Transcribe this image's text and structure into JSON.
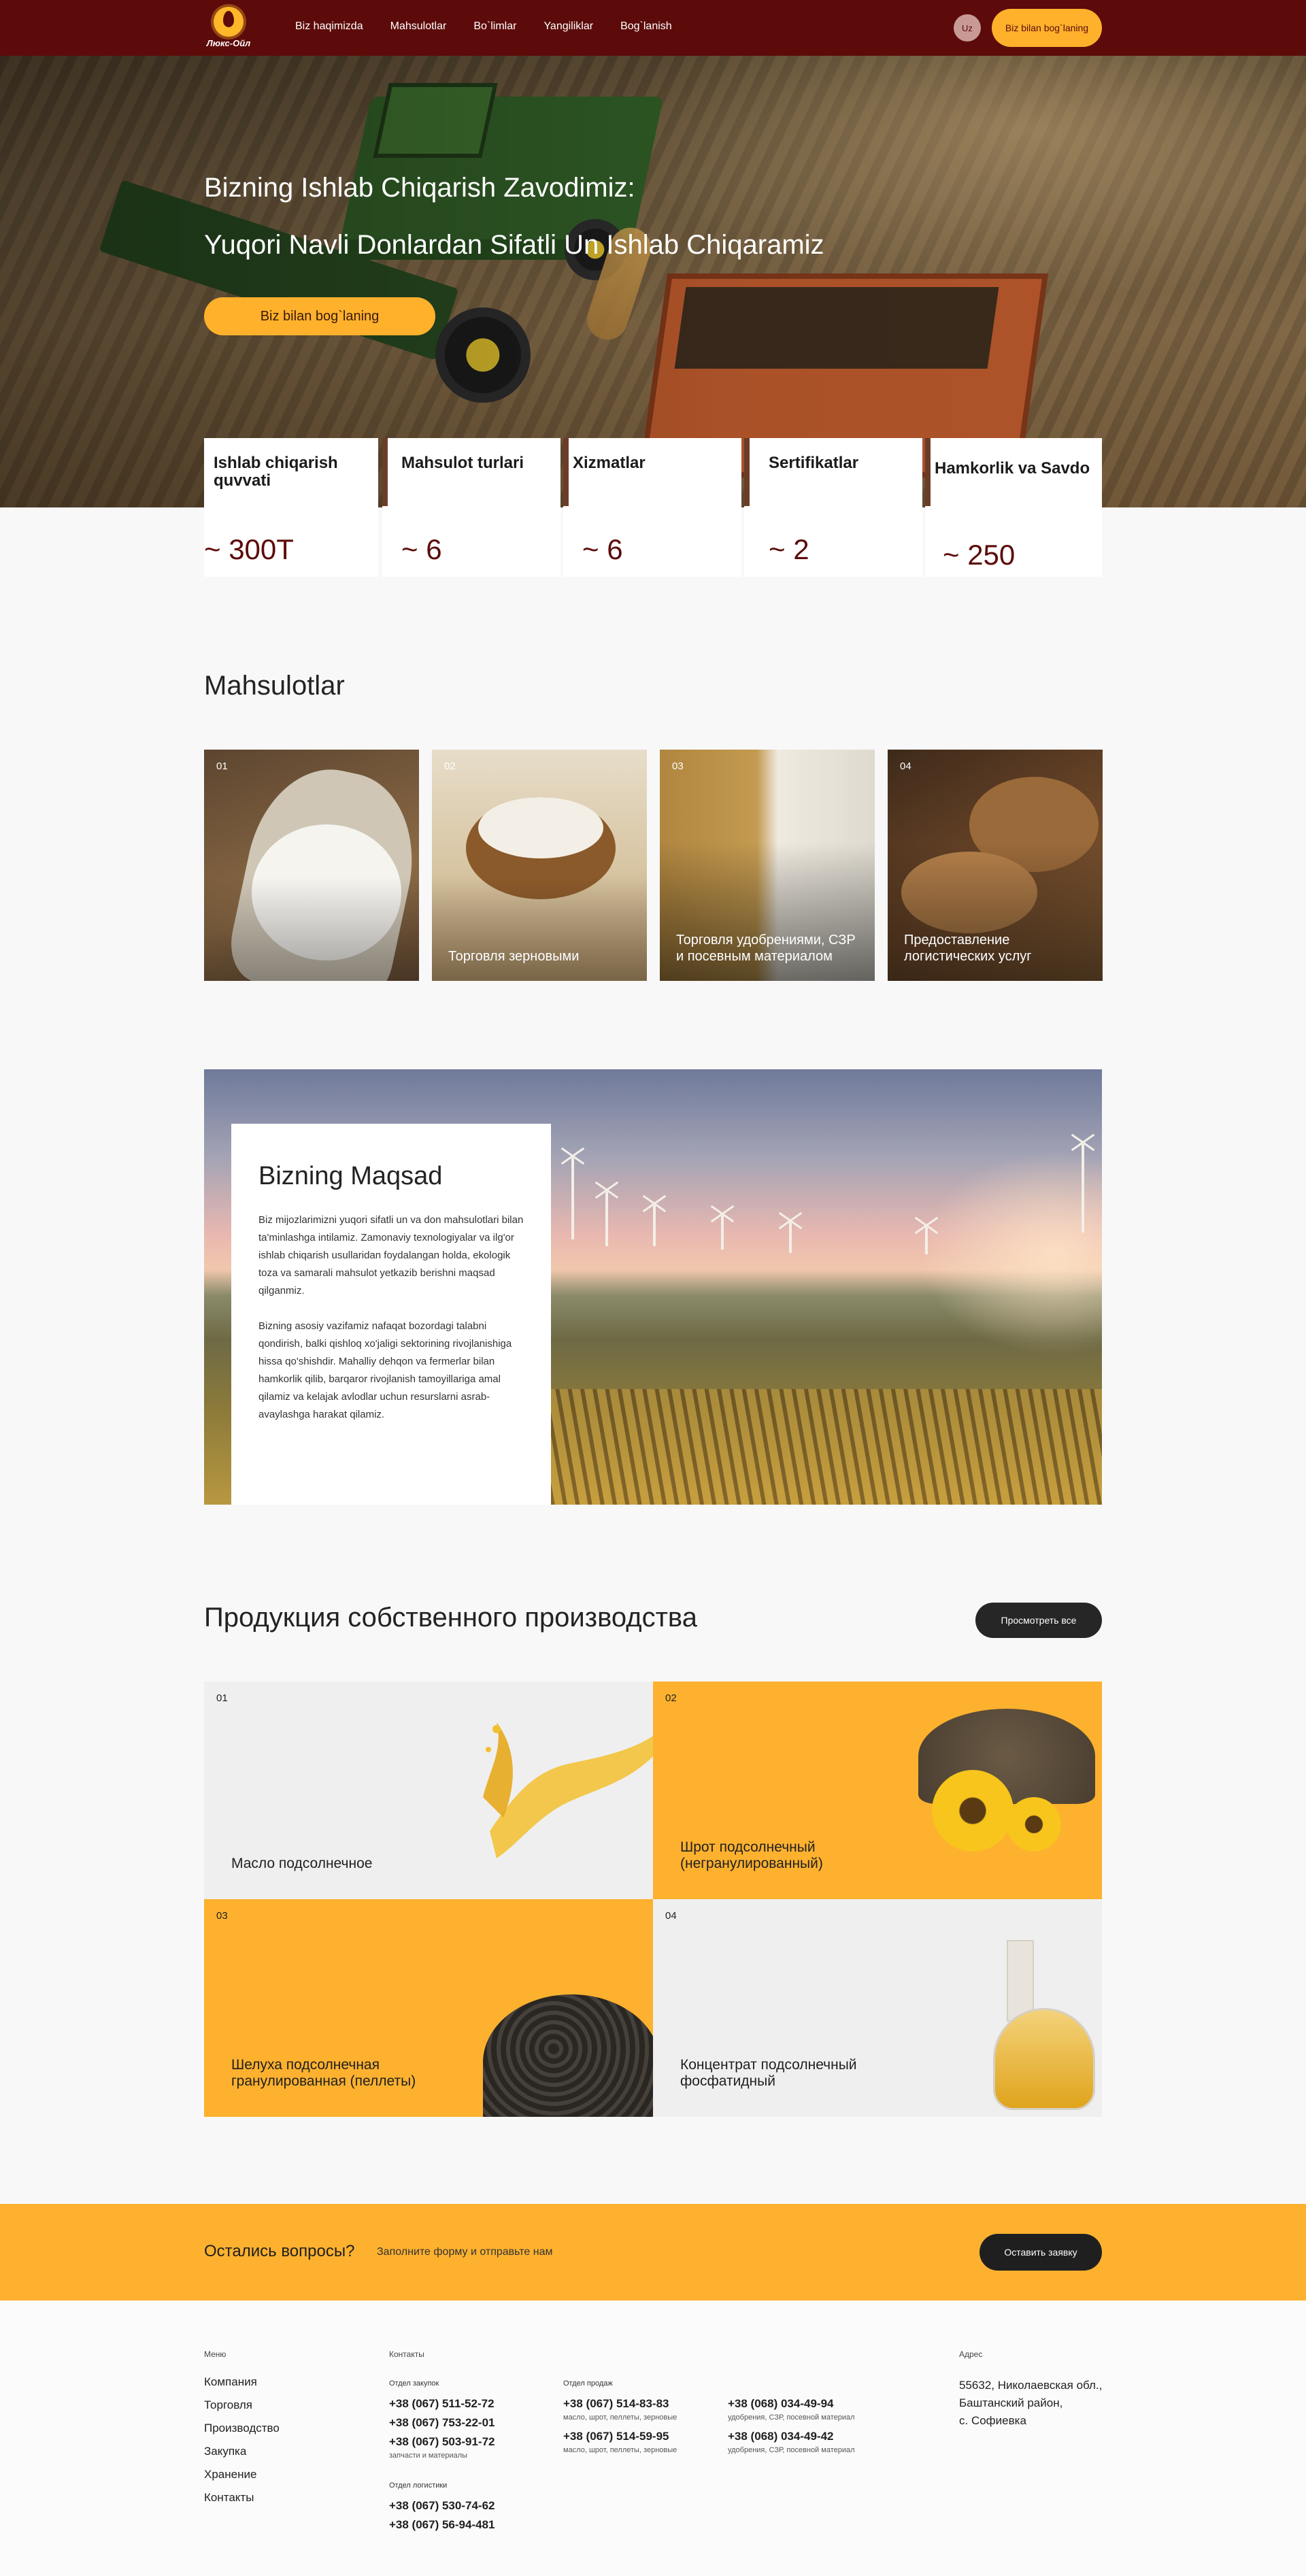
{
  "header": {
    "logo_text": "Люкс-Ойл",
    "nav": [
      "Biz haqimizda",
      "Mahsulotlar",
      "Bo`limlar",
      "Yangiliklar",
      "Bog`lanish"
    ],
    "lang": "Uz",
    "cta": "Biz bilan bog`laning"
  },
  "hero": {
    "title_line1": "Bizning Ishlab Chiqarish Zavodimiz:",
    "title_line2": "Yuqori Navli Donlardan Sifatli Un Ishlab Chiqaramiz",
    "button": "Biz bilan bog`laning"
  },
  "stats": [
    {
      "label": "Ishlab chiqarish quvvati",
      "value": "~ 300T"
    },
    {
      "label": "Mahsulot turlari",
      "value": "~ 6"
    },
    {
      "label": "Xizmatlar",
      "value": "~ 6"
    },
    {
      "label": "Sertifikatlar",
      "value": "~ 2"
    },
    {
      "label": "Hamkorlik va Savdo",
      "value": "~ 250"
    }
  ],
  "products": {
    "title": "Mahsulotlar",
    "items": [
      {
        "num": "01",
        "caption": ""
      },
      {
        "num": "02",
        "caption": "Торговля зерновыми"
      },
      {
        "num": "03",
        "caption": "Торговля удобрениями, СЗР и посевным материалом"
      },
      {
        "num": "04",
        "caption": "Предоставление логистических услуг"
      }
    ]
  },
  "goal": {
    "title": "Bizning Maqsad",
    "p1": "Biz mijozlarimizni yuqori sifatli un va don mahsulotlari bilan ta'minlashga intilamiz. Zamonaviy texnologiyalar va ilg'or ishlab chiqarish usullaridan foydalangan holda, ekologik toza va samarali mahsulot yetkazib berishni maqsad qilganmiz.",
    "p2": "Bizning asosiy vazifamiz nafaqat bozordagi talabni qondirish, balki qishloq xo'jaligi sektorining rivojlanishiga hissa qo'shishdir. Mahalliy dehqon va fermerlar bilan hamkorlik qilib, barqaror rivojlanish tamoyillariga amal qilamiz va kelajak avlodlar uchun resurslarni asrab-avaylashga harakat qilamiz."
  },
  "own": {
    "title": "Продукция собственного производства",
    "view_all": "Просмотреть все",
    "items": [
      {
        "num": "01",
        "caption": "Масло подсолнечное"
      },
      {
        "num": "02",
        "caption": "Шрот подсолнечный (негранулированный)"
      },
      {
        "num": "03",
        "caption": "Шелуха подсолнечная гранулированная (пеллеты)"
      },
      {
        "num": "04",
        "caption": "Концентрат подсолнечный фосфатидный"
      }
    ]
  },
  "callback": {
    "question": "Остались вопросы?",
    "sub": "Заполните форму и отправьте нам",
    "button": "Оставить заявку"
  },
  "footer": {
    "menu_head": "Меню",
    "menu": [
      "Компания",
      "Торговля",
      "Производство",
      "Закупка",
      "Хранение",
      "Контакты"
    ],
    "contacts_head": "Контакты",
    "purchase_head": "Отдел закупок",
    "purchase_phones": [
      "+38 (067) 511-52-72",
      "+38 (067) 753-22-01",
      "+38 (067) 503-91-72"
    ],
    "purchase_note": "запчасти и материалы",
    "logistics_head": "Отдел логистики",
    "logistics_phones": [
      "+38 (067) 530-74-62",
      "+38 (067) 56-94-481"
    ],
    "sales_head": "Отдел продаж",
    "sales": [
      {
        "phone": "+38 (067) 514-83-83",
        "note": "масло, шрот, пеллеты, зерновые"
      },
      {
        "phone": "+38 (067) 514-59-95",
        "note": "масло, шрот, пеллеты, зерновые"
      },
      {
        "phone": "+38 (068) 034-49-94",
        "note": "удобрения, СЗР, посевной материал"
      },
      {
        "phone": "+38 (068) 034-49-42",
        "note": "удобрения, СЗР, посевной материал"
      }
    ],
    "address_head": "Адрес",
    "address": [
      "55632, Николаевская обл.,",
      "Баштанский район,",
      "с. Софиевка"
    ]
  },
  "colors": {
    "header_bg": "#5c0b0a",
    "accent": "#fdb12f",
    "dark_button": "#262626"
  }
}
